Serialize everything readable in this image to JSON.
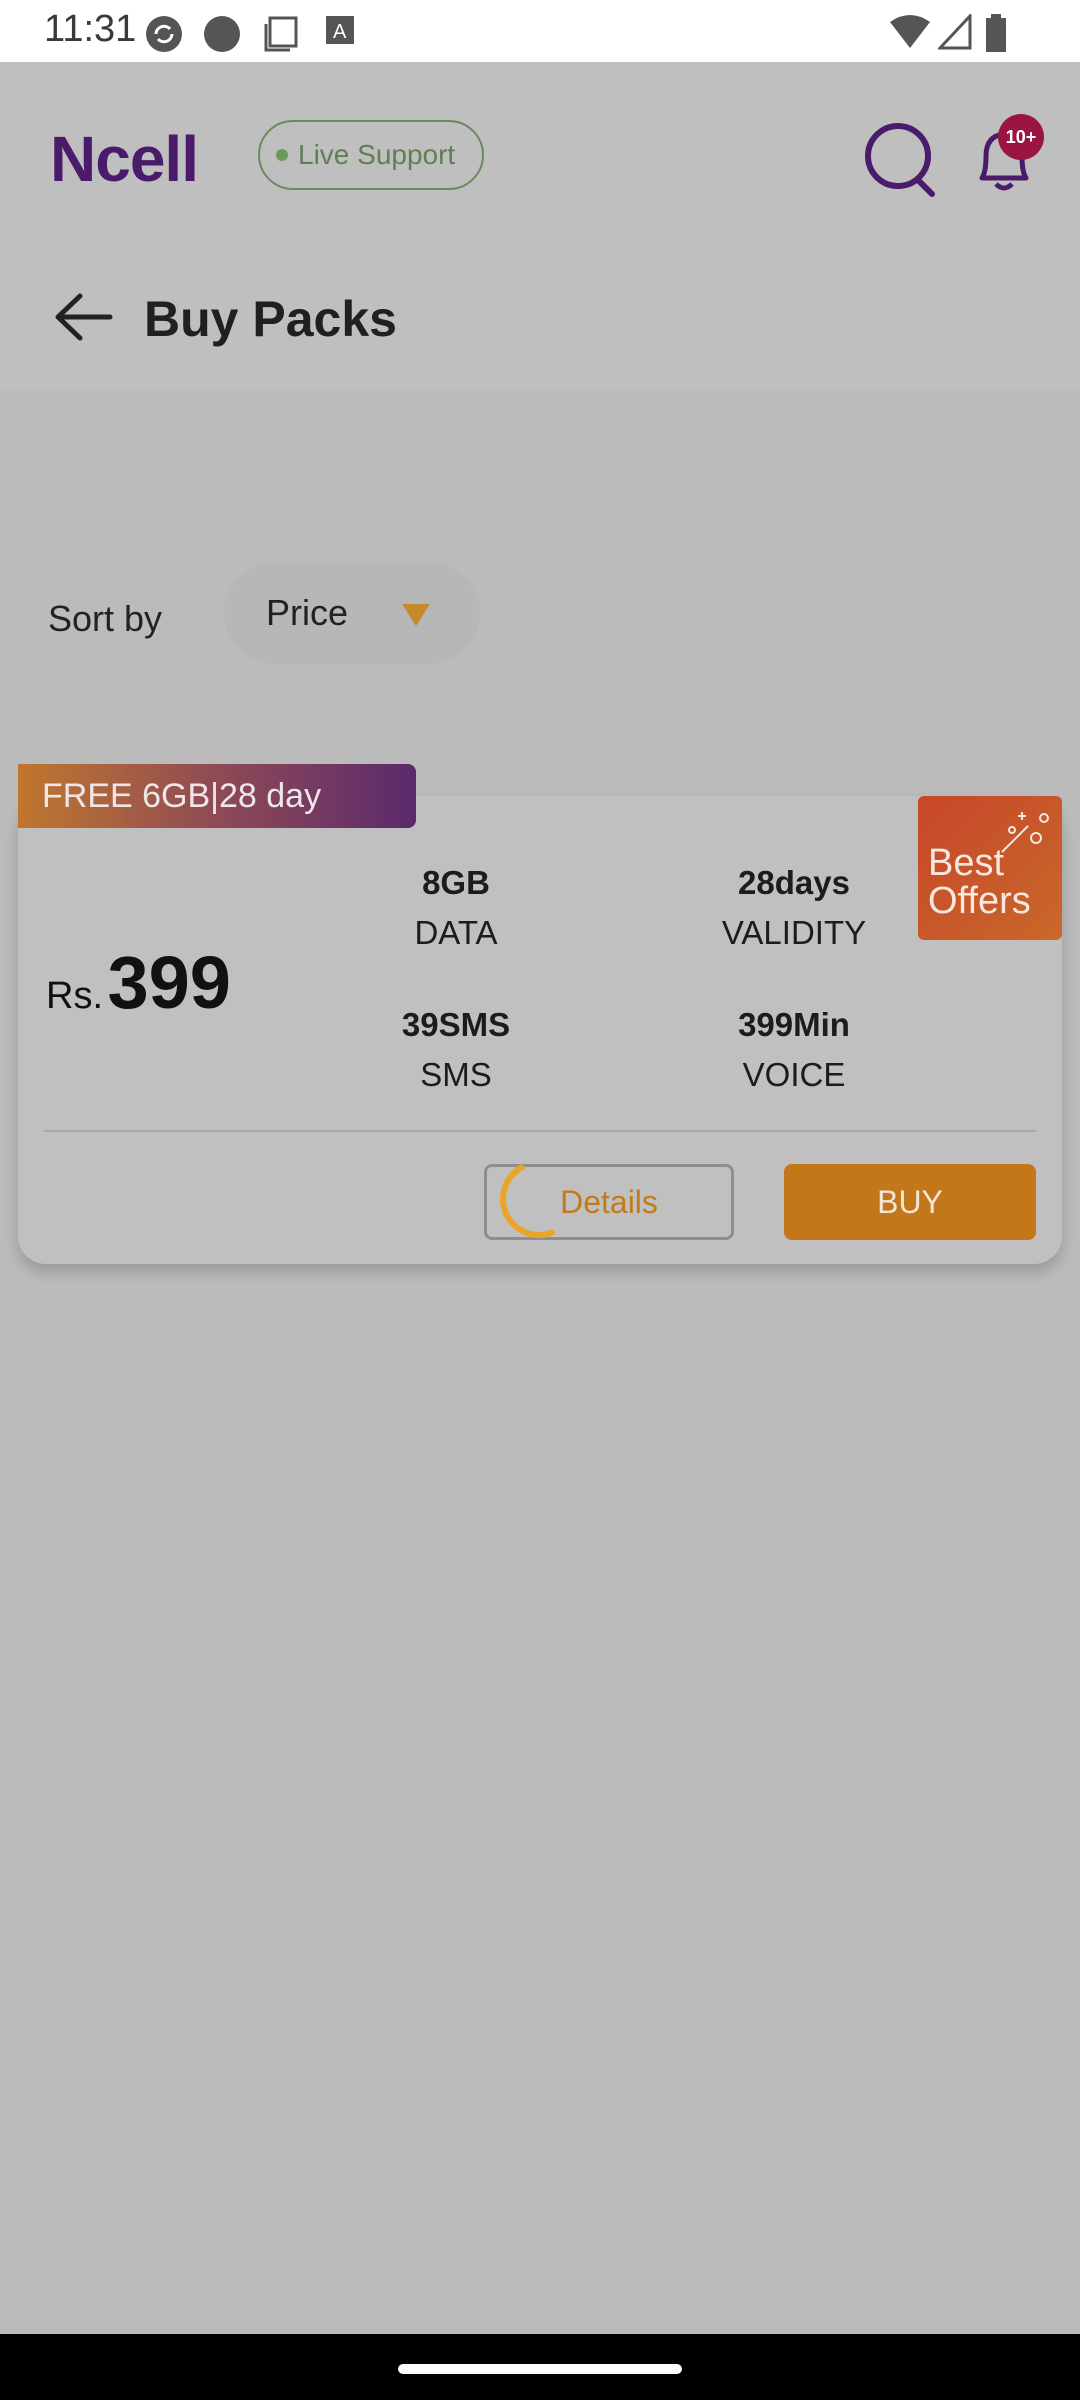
{
  "status_bar": {
    "time": "11:31",
    "left_icons": [
      "sync-icon",
      "circle-icon",
      "copy-icon",
      "keyboard-icon"
    ],
    "right_icons": [
      "wifi-icon",
      "signal-icon",
      "battery-icon"
    ]
  },
  "header": {
    "logo": "Ncell",
    "live_support": "Live Support",
    "notification_badge": "10+",
    "icons": [
      "search-icon",
      "bell-icon"
    ]
  },
  "page": {
    "title": "Buy Packs"
  },
  "sort": {
    "label": "Sort by",
    "value": "Price"
  },
  "pack": {
    "promo": "FREE 6GB|28 day",
    "best_offers": "Best Offers",
    "currency": "Rs.",
    "price": "399",
    "specs": [
      {
        "value": "8GB",
        "label": "DATA"
      },
      {
        "value": "28days",
        "label": "VALIDITY"
      },
      {
        "value": "39SMS",
        "label": "SMS"
      },
      {
        "value": "399Min",
        "label": "VOICE"
      }
    ],
    "details_label": "Details",
    "buy_label": "BUY"
  },
  "colors": {
    "brand_purple": "#4b1b6b",
    "accent_orange": "#c4761a",
    "badge_red": "#9a1640",
    "live_green": "#5f7f55"
  }
}
